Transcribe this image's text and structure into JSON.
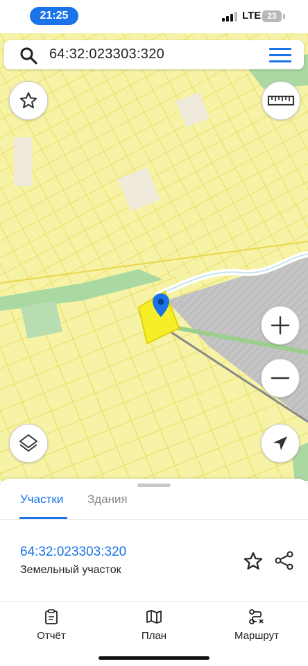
{
  "status_bar": {
    "time": "21:25",
    "network": "LTE",
    "battery": "23"
  },
  "search": {
    "query": "64:32:023303:320"
  },
  "map_controls": {
    "favorite": "star-icon",
    "ruler": "ruler-icon",
    "zoom_in": "plus-icon",
    "zoom_out": "minus-icon",
    "layers": "layers-icon",
    "locate": "navigation-arrow-icon"
  },
  "sheet": {
    "tabs": [
      {
        "label": "Участки",
        "active": true
      },
      {
        "label": "Здания",
        "active": false
      }
    ],
    "result": {
      "id": "64:32:023303:320",
      "type": "Земельный участок"
    }
  },
  "bottom_nav": [
    {
      "label": "Отчёт",
      "icon": "clipboard-icon"
    },
    {
      "label": "План",
      "icon": "map-icon"
    },
    {
      "label": "Маршрут",
      "icon": "route-icon"
    }
  ],
  "colors": {
    "accent": "#1a73e8",
    "parcel_fill": "#f6f2a6",
    "parcel_border": "#e6d84a",
    "selected_parcel": "#f7ee2a",
    "industrial": "#bdbdbd",
    "greenery": "#a9d8a0",
    "river": "#ffffff"
  }
}
